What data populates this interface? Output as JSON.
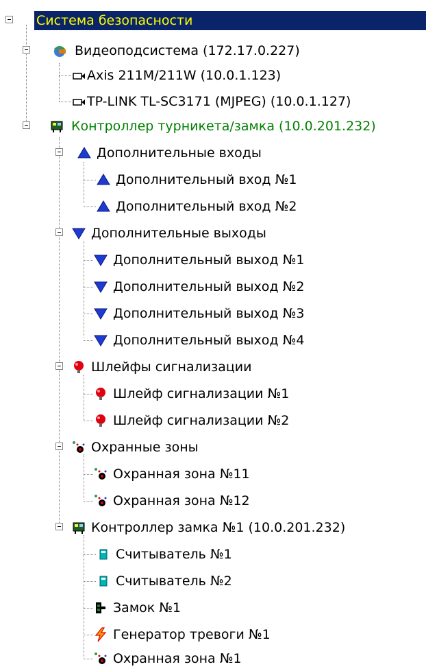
{
  "tree": {
    "root": {
      "label": "Система безопасности",
      "expanded": true,
      "selected": true,
      "icon": "tree-root"
    },
    "video": {
      "label": "Видеоподсистема (172.17.0.227)",
      "icon": "video-subsystem-icon",
      "cameras": [
        {
          "label": "Axis 211M/211W (10.0.1.123)",
          "icon": "camera-icon"
        },
        {
          "label": "TP-LINK TL-SC3171 (MJPEG) (10.0.1.127)",
          "icon": "camera-icon"
        }
      ]
    },
    "controller": {
      "label": "Контроллер турникета/замка (10.0.201.232)",
      "icon": "controller-icon",
      "color": "#008000",
      "inputs": {
        "label": "Дополнительные входы",
        "icon": "triangle-up-icon",
        "items": [
          "Дополнительный вход №1",
          "Дополнительный вход №2"
        ]
      },
      "outputs": {
        "label": "Дополнительные выходы",
        "icon": "triangle-down-icon",
        "items": [
          "Дополнительный выход №1",
          "Дополнительный выход №2",
          "Дополнительный выход №3",
          "Дополнительный выход №4"
        ]
      },
      "loops": {
        "label": "Шлейфы сигнализации",
        "icon": "alarm-loop-icon",
        "items": [
          "Шлейф сигнализации №1",
          "Шлейф сигнализации №2"
        ]
      },
      "zones": {
        "label": "Охранные зоны",
        "icon": "security-zone-icon",
        "items": [
          "Охранная зона №11",
          "Охранная зона №12"
        ]
      },
      "lock_controller": {
        "label": "Контроллер замка №1 (10.0.201.232)",
        "icon": "controller-icon",
        "items": [
          {
            "label": "Считыватель №1",
            "icon": "reader-icon"
          },
          {
            "label": "Считыватель №2",
            "icon": "reader-icon"
          },
          {
            "label": "Замок №1",
            "icon": "lock-icon"
          },
          {
            "label": "Генератор тревоги №1",
            "icon": "alarm-generator-icon"
          },
          {
            "label": "Охранная зона №1",
            "icon": "security-zone-icon"
          }
        ]
      }
    }
  },
  "colors": {
    "selection_bg": "#0a246a",
    "selection_fg": "#ffff00",
    "green_text": "#008000",
    "tree_lines": "#808080"
  }
}
